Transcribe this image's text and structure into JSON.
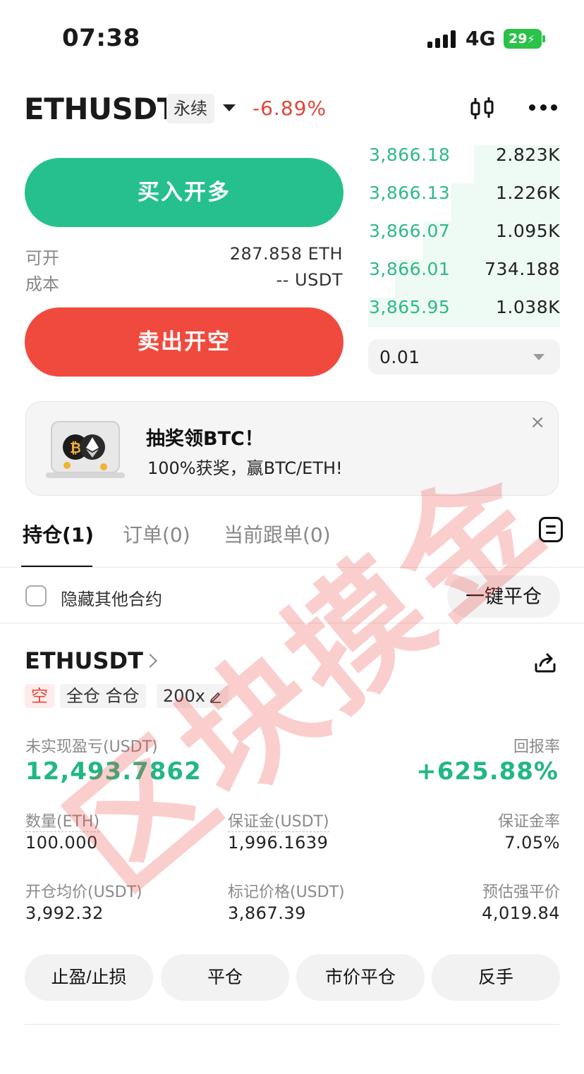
{
  "status_bar": {
    "time": "07:38",
    "network": "4G",
    "battery": "29"
  },
  "header": {
    "pair": "ETHUSDT",
    "contract_type": "永续",
    "change": "-6.89%"
  },
  "trade": {
    "buy_label": "买入开多",
    "sell_label": "卖出开空",
    "available_label": "可开",
    "available_value": "287.858 ETH",
    "cost_label": "成本",
    "cost_value": "-- USDT"
  },
  "order_book": {
    "rows": [
      {
        "price": "3,866.18",
        "qty": "2.823K"
      },
      {
        "price": "3,866.13",
        "qty": "1.226K"
      },
      {
        "price": "3,866.07",
        "qty": "1.095K"
      },
      {
        "price": "3,866.01",
        "qty": "734.188"
      },
      {
        "price": "3,865.95",
        "qty": "1.038K"
      }
    ],
    "step": "0.01"
  },
  "promo": {
    "title": "抽奖领BTC！",
    "subtitle": "100%获奖，赢BTC/ETH!",
    "close": "×"
  },
  "tabs": [
    {
      "label": "持仓(1)"
    },
    {
      "label": "订单(0)"
    },
    {
      "label": "当前跟单(0)"
    }
  ],
  "filter": {
    "hide_label": "隐藏其他合约",
    "close_all": "一键平仓"
  },
  "position": {
    "pair": "ETHUSDT",
    "side": "空",
    "margin_mode": "全仓 合仓",
    "leverage": "200x",
    "pnl_label": "未实现盈亏(USDT)",
    "pnl_value": "12,493.7862",
    "roe_label": "回报率",
    "roe_value": "+625.88%",
    "qty_label": "数量(ETH)",
    "qty_value": "100.000",
    "margin_label": "保证金(USDT)",
    "margin_value": "1,996.1639",
    "margin_ratio_label": "保证金率",
    "margin_ratio_value": "7.05%",
    "entry_label": "开仓均价(USDT)",
    "entry_value": "3,992.32",
    "mark_label": "标记价格(USDT)",
    "mark_value": "3,867.39",
    "liq_label": "预估强平价",
    "liq_value": "4,019.84",
    "actions": [
      "止盈/止损",
      "平仓",
      "市价平仓",
      "反手"
    ]
  },
  "watermark": "区块摸金",
  "colors": {
    "buy": "#25c08d",
    "sell": "#f04a3e",
    "profit": "#22b784",
    "loss": "#e0453a"
  }
}
